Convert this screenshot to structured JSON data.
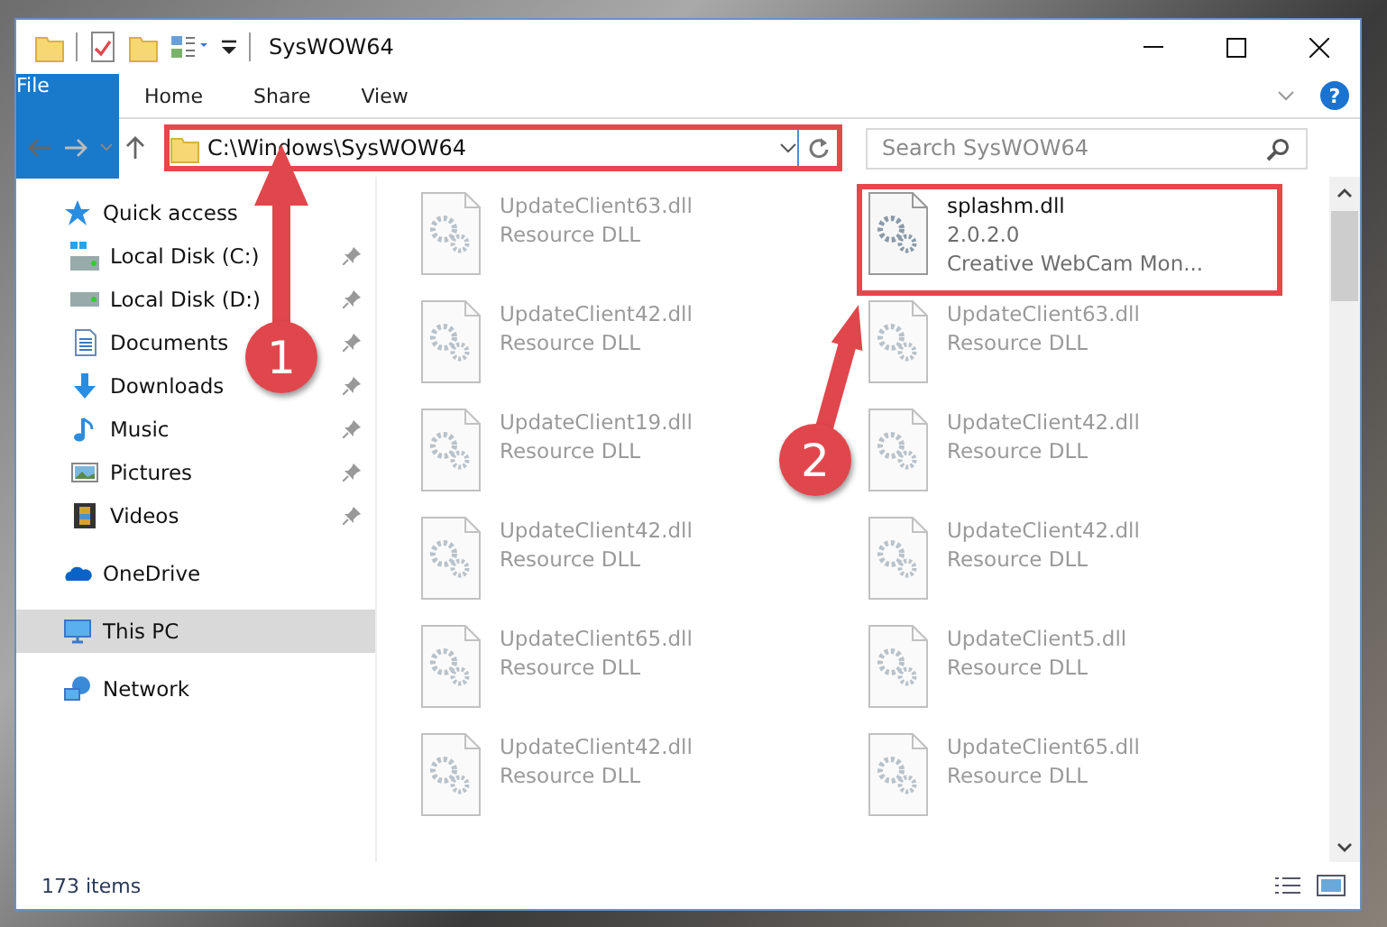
{
  "window": {
    "title": "SysWOW64"
  },
  "ribbon": {
    "tabs": [
      {
        "label": "File",
        "kind": "file"
      },
      {
        "label": "Home",
        "kind": "tab"
      },
      {
        "label": "Share",
        "kind": "tab"
      },
      {
        "label": "View",
        "kind": "tab"
      }
    ],
    "help": "?"
  },
  "address": {
    "path": "C:\\Windows\\SysWOW64",
    "annotated": true
  },
  "search": {
    "placeholder": "Search SysWOW64"
  },
  "sidebar": {
    "items": [
      {
        "label": "Quick access",
        "kind": "group",
        "selected": false
      },
      {
        "label": "Local Disk (C:)",
        "kind": "place",
        "pinned": true,
        "selected": false
      },
      {
        "label": "Local Disk (D:)",
        "kind": "place",
        "pinned": true,
        "selected": false
      },
      {
        "label": "Documents",
        "kind": "place",
        "pinned": true,
        "selected": false
      },
      {
        "label": "Downloads",
        "kind": "place",
        "pinned": true,
        "selected": false
      },
      {
        "label": "Music",
        "kind": "place",
        "pinned": true,
        "selected": false
      },
      {
        "label": "Pictures",
        "kind": "place",
        "pinned": true,
        "selected": false
      },
      {
        "label": "Videos",
        "kind": "place",
        "pinned": true,
        "selected": false
      },
      {
        "label": "OneDrive",
        "kind": "group",
        "selected": false
      },
      {
        "label": "This PC",
        "kind": "group",
        "selected": true
      },
      {
        "label": "Network",
        "kind": "group",
        "selected": false
      }
    ]
  },
  "files": [
    {
      "name": "UpdateClient63.dll",
      "details": [
        "Resource DLL"
      ],
      "faded": true,
      "annotated": false
    },
    {
      "name": "splashm.dll",
      "details": [
        "2.0.2.0",
        "Creative WebCam Mon..."
      ],
      "faded": false,
      "annotated": true
    },
    {
      "name": "UpdateClient42.dll",
      "details": [
        "Resource DLL"
      ],
      "faded": true,
      "annotated": false
    },
    {
      "name": "UpdateClient63.dll",
      "details": [
        "Resource DLL"
      ],
      "faded": true,
      "annotated": false
    },
    {
      "name": "UpdateClient19.dll",
      "details": [
        "Resource DLL"
      ],
      "faded": true,
      "annotated": false
    },
    {
      "name": "UpdateClient42.dll",
      "details": [
        "Resource DLL"
      ],
      "faded": true,
      "annotated": false
    },
    {
      "name": "UpdateClient42.dll",
      "details": [
        "Resource DLL"
      ],
      "faded": true,
      "annotated": false
    },
    {
      "name": "UpdateClient42.dll",
      "details": [
        "Resource DLL"
      ],
      "faded": true,
      "annotated": false
    },
    {
      "name": "UpdateClient65.dll",
      "details": [
        "Resource DLL"
      ],
      "faded": true,
      "annotated": false
    },
    {
      "name": "UpdateClient5.dll",
      "details": [
        "Resource DLL"
      ],
      "faded": true,
      "annotated": false
    },
    {
      "name": "UpdateClient42.dll",
      "details": [
        "Resource DLL"
      ],
      "faded": true,
      "annotated": false
    },
    {
      "name": "UpdateClient65.dll",
      "details": [
        "Resource DLL"
      ],
      "faded": true,
      "annotated": false
    }
  ],
  "status_bar": {
    "count": "173 items"
  },
  "callouts": [
    {
      "label": "1"
    },
    {
      "label": "2"
    }
  ]
}
